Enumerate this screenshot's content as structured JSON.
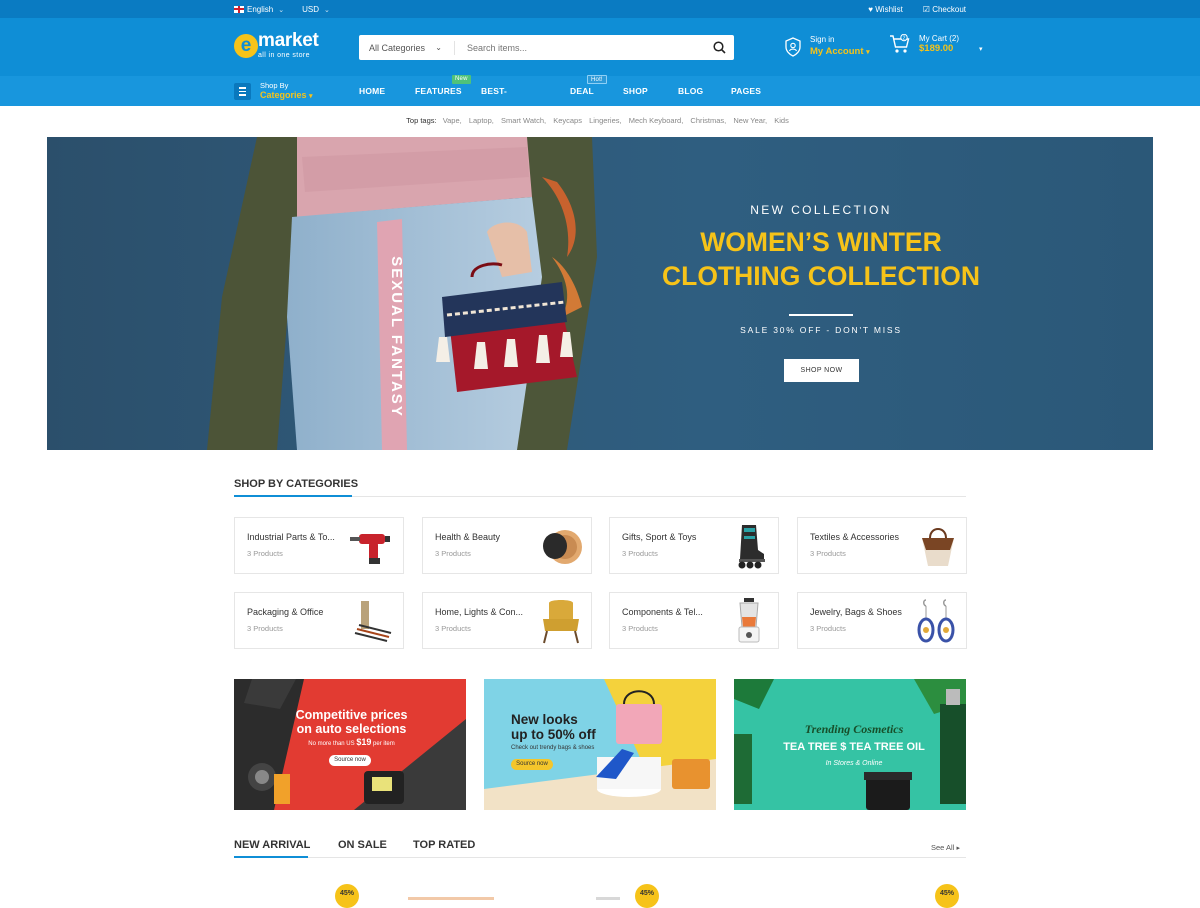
{
  "topbar": {
    "language": "English",
    "currency": "USD",
    "wishlist": "Wishlist",
    "checkout": "Checkout"
  },
  "header": {
    "logo_letter": "e",
    "logo_word": "market",
    "logo_tagline": "all in one store",
    "search_category": "All Categories",
    "search_placeholder": "Search items...",
    "signin": "Sign in",
    "my_account": "My Account",
    "cart_label": "My Cart (2)",
    "cart_total": "$189.00"
  },
  "nav": {
    "shop_by": "Shop By",
    "categories": "Categories",
    "items": [
      {
        "label": "HOME"
      },
      {
        "label": "FEATURES",
        "badge": "New"
      },
      {
        "label": "BEST-SELLING"
      },
      {
        "label": "DEAL",
        "badge": "Hot!"
      },
      {
        "label": "SHOP"
      },
      {
        "label": "BLOG"
      },
      {
        "label": "PAGES"
      }
    ]
  },
  "top_tags": {
    "label": "Top tags:",
    "tags": [
      "Vape,",
      "Laptop,",
      "Smart Watch,",
      "Keycaps",
      "Lingeries,",
      "Mech Keyboard,",
      "Christmas,",
      "New Year,",
      "Kids"
    ]
  },
  "hero": {
    "subtitle": "NEW COLLECTION",
    "title_line1": "WOMEN’S WINTER",
    "title_line2": "CLOTHING COLLECTION",
    "sale_text": "SALE 30% OFF - DON'T MISS",
    "button": "SHOP NOW",
    "jeans_text": "SEXUAL FANTASY"
  },
  "categories": {
    "title": "SHOP BY CATEGORIES",
    "items": [
      {
        "name": "Industrial Parts & To...",
        "count": "3 Products",
        "icon": "impact-wrench"
      },
      {
        "name": "Health & Beauty",
        "count": "3 Products",
        "icon": "powder-compact"
      },
      {
        "name": "Gifts, Sport & Toys",
        "count": "3 Products",
        "icon": "roller-skate"
      },
      {
        "name": "Textiles & Accessories",
        "count": "3 Products",
        "icon": "handbag"
      },
      {
        "name": "Packaging & Office",
        "count": "3 Products",
        "icon": "pen-set"
      },
      {
        "name": "Home, Lights & Con...",
        "count": "3 Products",
        "icon": "armchair"
      },
      {
        "name": "Components & Tel...",
        "count": "3 Products",
        "icon": "blender"
      },
      {
        "name": "Jewelry, Bags & Shoes",
        "count": "3 Products",
        "icon": "earrings"
      }
    ]
  },
  "banners": [
    {
      "line1": "Competitive prices",
      "line2": "on auto selections",
      "note_prefix": "No more than US",
      "note_price": "$19",
      "note_suffix": "per item",
      "button": "Source now",
      "color": "#e23b32"
    },
    {
      "line1": "New looks",
      "line2": "up to 50% off",
      "note": "Check out trendy bags & shoes",
      "button": "Source now",
      "color": "#7fd3e6"
    },
    {
      "line1": "Trending Cosmetics",
      "line2": "TEA TREE $ TEA TREE OIL",
      "note": "In Stores & Online",
      "color": "#35c3a4"
    }
  ],
  "product_tabs": {
    "tabs": [
      "NEW ARRIVAL",
      "ON SALE",
      "TOP RATED"
    ],
    "see_all": "See All",
    "discounts": [
      "45%",
      "45%",
      "45%"
    ]
  },
  "colors": {
    "primary": "#0f8ed6",
    "nav": "#1896dd",
    "topbar": "#0a7bc2",
    "accent_yellow": "#f6c319"
  }
}
